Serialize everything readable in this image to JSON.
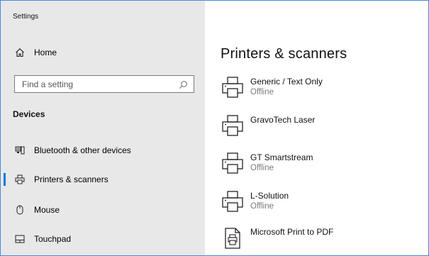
{
  "window": {
    "title": "Settings"
  },
  "sidebar": {
    "home_label": "Home",
    "search_placeholder": "Find a setting",
    "section_heading": "Devices",
    "items": [
      {
        "label": "Bluetooth & other devices",
        "icon": "bluetooth-devices-icon",
        "selected": false
      },
      {
        "label": "Printers & scanners",
        "icon": "printer-icon",
        "selected": true
      },
      {
        "label": "Mouse",
        "icon": "mouse-icon",
        "selected": false
      },
      {
        "label": "Touchpad",
        "icon": "touchpad-icon",
        "selected": false
      }
    ]
  },
  "main": {
    "title": "Printers & scanners",
    "printers": [
      {
        "name": "Generic / Text Only",
        "status": "Offline",
        "icon": "printer-icon"
      },
      {
        "name": "GravoTech Laser",
        "status": "",
        "icon": "printer-icon"
      },
      {
        "name": "GT Smartstream",
        "status": "Offline",
        "icon": "printer-icon"
      },
      {
        "name": "L-Solution",
        "status": "Offline",
        "icon": "printer-icon"
      },
      {
        "name": "Microsoft Print to PDF",
        "status": "",
        "icon": "pdf-printer-icon"
      }
    ]
  },
  "colors": {
    "accent": "#0078d7",
    "sidebar_bg": "#e8e8e8",
    "window_border": "#4a89d8",
    "secondary_text": "#7a7a7a"
  }
}
